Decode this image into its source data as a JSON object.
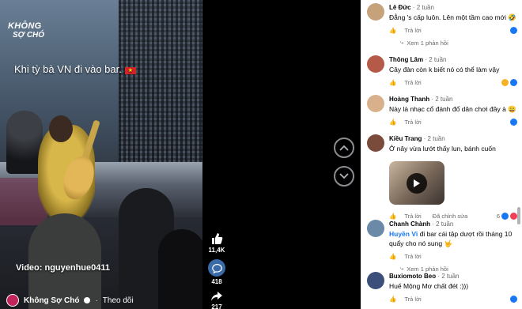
{
  "video": {
    "brand_line1": "KHÔNG",
    "brand_line2": "SỢ CHÓ",
    "caption": "Khi tỳ bà VN đi vào bar.",
    "caption_flag": "★",
    "watermark": "Video: nguyenhue0411",
    "channel": {
      "name": "Không Sợ Chó",
      "dot": "·",
      "follow": "Theo dõi"
    },
    "actions": {
      "likes": "11,4K",
      "comments": "418",
      "shares": "217"
    }
  },
  "comments": [
    {
      "name": "Lê Đức",
      "time": "· 2 tuần",
      "text": "Đẳng 's cấp luôn. Lên một tầm cao mới 🤣",
      "reply": "Trả lời",
      "avatar_color": "#c6a27a",
      "replies_link": "Xem 1 phản hồi"
    },
    {
      "name": "Thông Lâm",
      "time": "· 2 tuần",
      "text": "Cây đàn còn k biết nó có thể làm vậy",
      "reply": "Trả lời",
      "avatar_color": "#b55a48"
    },
    {
      "name": "Hoàng Thanh",
      "time": "· 2 tuần",
      "text": "Này là nhạc cổ đánh đổ dân chơi đây à 😄",
      "reply": "Trả lời",
      "avatar_color": "#d9b08c"
    },
    {
      "name": "Kiều Trang",
      "time": "· 2 tuần",
      "text": "Ở nây vừa lướt thấy lun, bánh cuốn",
      "reply": "Trả lời",
      "edited": "Đã chỉnh sửa",
      "reaction_count": "6",
      "avatar_color": "#7a4a3a"
    },
    {
      "name": "Chanh Chành",
      "time": "· 2 tuần",
      "mention": "Huyền Vi",
      "text": "đi bar cái tập dượt rồi tháng 10 quẩy cho nó sung 🤟",
      "reply": "Trả lời",
      "avatar_color": "#6b8aa8",
      "replies_link": "Xem 1 phản hồi"
    },
    {
      "name": "Buxiomoto Beo",
      "time": "· 2 tuần",
      "text": "Huế Mộng Mơ chất đét :)))",
      "reply": "Trả lời",
      "avatar_color": "#3b4f7a"
    }
  ],
  "labels": {
    "like": "Thích"
  }
}
